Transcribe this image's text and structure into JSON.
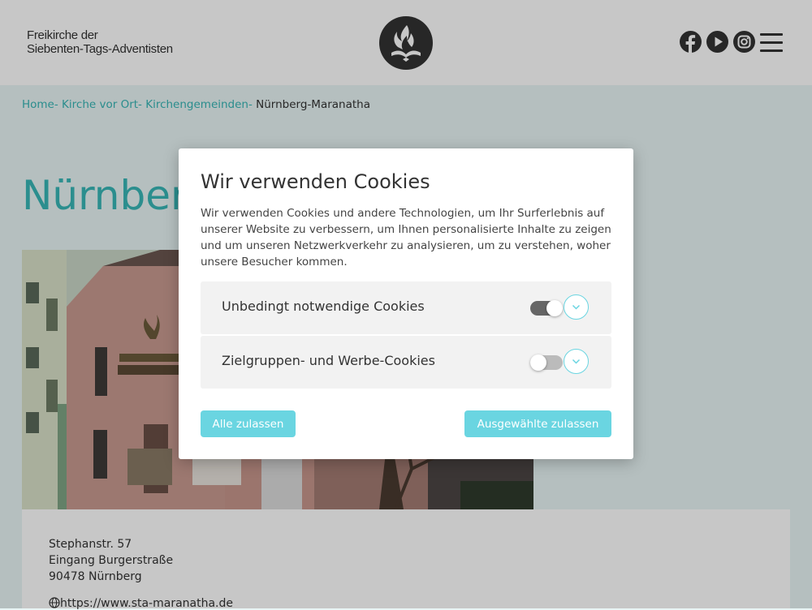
{
  "header": {
    "brand_line1": "Freikirche der",
    "brand_line2": "Siebenten-Tags-Adventisten",
    "logo_icon": "adventist-flame-logo-icon",
    "social_icons": [
      "facebook-icon",
      "youtube-icon",
      "instagram-icon"
    ],
    "menu_icon": "hamburger-menu-icon"
  },
  "breadcrumb": {
    "items": [
      "Home-",
      "Kirche vor Ort-",
      "Kirchengemeinden-"
    ],
    "current": "Nürnberg-Maranatha"
  },
  "page": {
    "title": "Nürnberg-Maranatha"
  },
  "address": {
    "street": "Stephanstr. 57",
    "entrance": "Eingang Burgerstraße",
    "city": "90478 Nürnberg",
    "website": "https://www.sta-maranatha.de",
    "website_icon": "globe-icon"
  },
  "cookie_modal": {
    "title": "Wir verwenden Cookies",
    "description": "Wir verwenden Cookies und andere Technologien, um Ihr Surferlebnis auf unserer Website zu verbessern, um Ihnen personalisierte Inhalte zu zeigen und um unseren Netzwerkverkehr zu analysieren, um zu verstehen, woher unsere Besucher kommen.",
    "categories": [
      {
        "label": "Unbedingt notwendige Cookies",
        "enabled": true
      },
      {
        "label": "Zielgruppen- und Werbe-Cookies",
        "enabled": false
      }
    ],
    "accept_all_label": "Alle zulassen",
    "accept_selected_label": "Ausgewählte zulassen"
  },
  "colors": {
    "accent": "#38b6b6",
    "button": "#6ad5e1",
    "header_bg": "#ffffff",
    "text": "#333333"
  }
}
